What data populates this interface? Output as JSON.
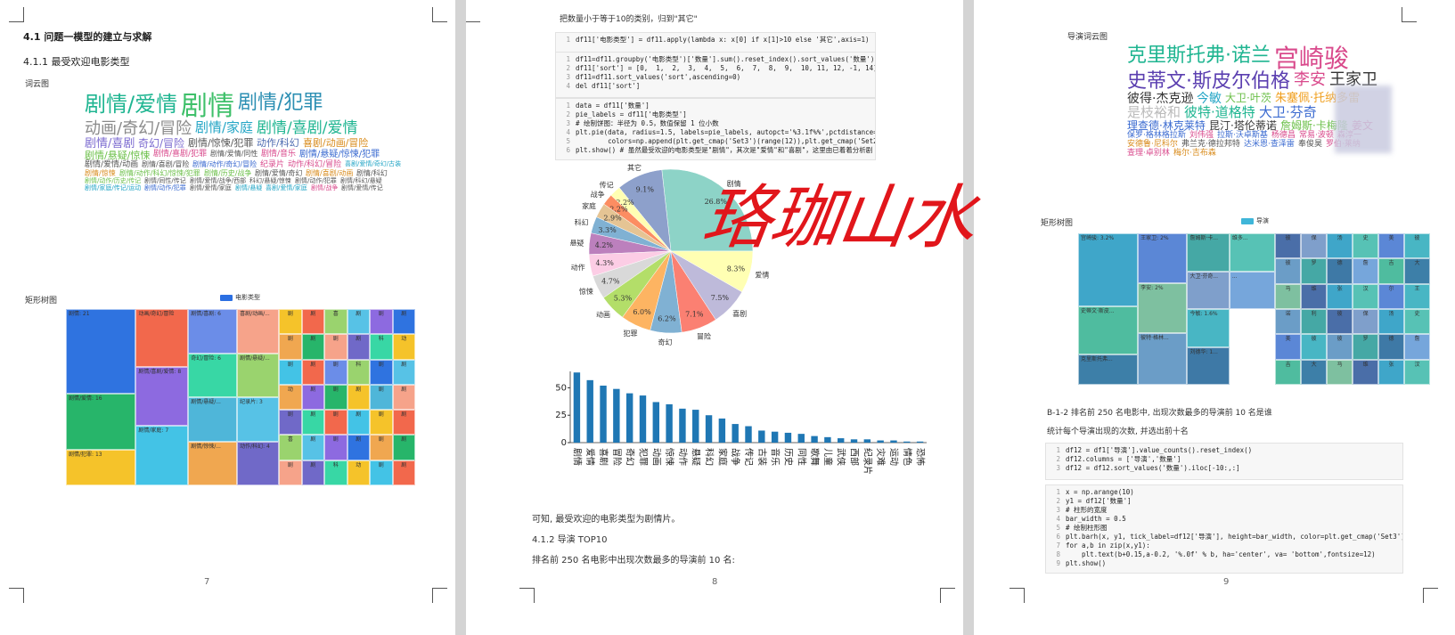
{
  "pages": [
    {
      "number": "7",
      "heading": "4.1 问题一模型的建立与求解",
      "subheading": "4.1.1 最受欢迎电影类型",
      "wordcloud_label": "词云图",
      "treemap_label": "矩形树图",
      "treemap_legend": "电影类型",
      "wordcloud": [
        {
          "t": "剧情/爱情",
          "c": "#1fb591",
          "s": 24
        },
        {
          "t": "剧情",
          "c": "#3fc06a",
          "s": 30
        },
        {
          "t": "剧情/犯罪",
          "c": "#2c8fb3",
          "s": 22
        },
        {
          "t": "动画/奇幻/冒险",
          "c": "#8a8a8a",
          "s": 18
        },
        {
          "t": "剧情/家庭",
          "c": "#25a6c6",
          "s": 15
        },
        {
          "t": "剧情/喜剧/爱情",
          "c": "#1fb591",
          "s": 17
        },
        {
          "t": "剧情/喜剧",
          "c": "#7c6bd0",
          "s": 13
        },
        {
          "t": "奇幻/冒险",
          "c": "#7c6bd0",
          "s": 12
        },
        {
          "t": "剧情/惊悚/犯罪",
          "c": "#555",
          "s": 11
        },
        {
          "t": "动作/科幻",
          "c": "#4c6ab0",
          "s": 11
        },
        {
          "t": "喜剧/动画/冒险",
          "c": "#d98c1e",
          "s": 11
        },
        {
          "t": "剧情/悬疑/惊悚",
          "c": "#6cc04a",
          "s": 11
        },
        {
          "t": "剧情/喜剧/犯罪",
          "c": "#d94a8c",
          "s": 9
        },
        {
          "t": "剧情/爱情/同性",
          "c": "#555",
          "s": 8
        },
        {
          "t": "剧情/音乐",
          "c": "#d94a8c",
          "s": 9
        },
        {
          "t": "剧情/悬疑/惊悚/犯罪",
          "c": "#3a6ad0",
          "s": 10
        },
        {
          "t": "剧情/爱情/动画",
          "c": "#555",
          "s": 9
        },
        {
          "t": "剧情/喜剧/冒险",
          "c": "#555",
          "s": 8
        },
        {
          "t": "剧情/动作/奇幻/冒险",
          "c": "#3a6ad0",
          "s": 8
        },
        {
          "t": "纪录片",
          "c": "#d94a8c",
          "s": 9
        },
        {
          "t": "动作/科幻/冒险",
          "c": "#d94a8c",
          "s": 9
        },
        {
          "t": "喜剧/爱情/奇幻/古装",
          "c": "#25a6c6",
          "s": 7
        },
        {
          "t": "剧情/惊悚",
          "c": "#d98c1e",
          "s": 8
        },
        {
          "t": "剧情/动作/科幻/惊悚/犯罪",
          "c": "#6cc04a",
          "s": 8
        },
        {
          "t": "剧情/历史/战争",
          "c": "#6cc04a",
          "s": 8
        },
        {
          "t": "剧情/爱情/奇幻",
          "c": "#555",
          "s": 8
        },
        {
          "t": "剧情/喜剧/动画",
          "c": "#d98c1e",
          "s": 8
        },
        {
          "t": "剧情/科幻",
          "c": "#555",
          "s": 8
        },
        {
          "t": "剧情/动作/历史/传记",
          "c": "#6cc04a",
          "s": 7
        },
        {
          "t": "剧情/同性/传记",
          "c": "#555",
          "s": 7
        },
        {
          "t": "剧情/爱情/战争/西部",
          "c": "#555",
          "s": 7
        },
        {
          "t": "科幻/悬疑/惊悚",
          "c": "#555",
          "s": 7
        },
        {
          "t": "剧情/动作/犯罪",
          "c": "#555",
          "s": 7
        },
        {
          "t": "剧情/科幻/悬疑",
          "c": "#555",
          "s": 7
        },
        {
          "t": "剧情/家庭/传记/运动",
          "c": "#25a6c6",
          "s": 7
        },
        {
          "t": "剧情/动作/犯罪",
          "c": "#3a6ad0",
          "s": 7
        },
        {
          "t": "剧情/爱情/家庭",
          "c": "#555",
          "s": 7
        },
        {
          "t": "剧情/悬疑",
          "c": "#25a6c6",
          "s": 7
        },
        {
          "t": "喜剧/爱情/家庭",
          "c": "#25a6c6",
          "s": 7
        },
        {
          "t": "剧情/战争",
          "c": "#d94a8c",
          "s": 7
        },
        {
          "t": "剧情/爱情/传记",
          "c": "#555",
          "s": 7
        }
      ],
      "treemap": [
        {
          "label": "剧情: 21",
          "c": "#2f73e0"
        },
        {
          "label": "剧情/爱情: 16",
          "c": "#27b56a"
        },
        {
          "label": "剧情/犯罪: 13",
          "c": "#f5c32a"
        },
        {
          "label": "动画/奇幻/冒险",
          "c": "#f2684c"
        },
        {
          "label": "剧情/喜剧/爱情: 8",
          "c": "#8d6ae0"
        },
        {
          "label": "剧情/家庭: 7",
          "c": "#43c3e6"
        },
        {
          "label": "剧情/喜剧: 6",
          "c": "#6b8de8"
        },
        {
          "label": "奇幻/冒险: 6",
          "c": "#38d7a5"
        },
        {
          "label": "剧情/悬疑/...",
          "c": "#4fb6d9"
        },
        {
          "label": "剧情/惊悚/...",
          "c": "#f0a750"
        },
        {
          "label": "喜剧/动画/...",
          "c": "#f6a38a"
        },
        {
          "label": "剧情/悬疑/...",
          "c": "#9ad36e"
        },
        {
          "label": "纪录片: 3",
          "c": "#57c2e6"
        },
        {
          "label": "动作/科幻: 4",
          "c": "#7069c8"
        },
        {
          "label": "剧情/...",
          "c": "#3cc2a8"
        }
      ],
      "treemap_small": [
        {
          "label": "剧",
          "c": "#f5c32a"
        },
        {
          "label": "剧",
          "c": "#f2684c"
        },
        {
          "label": "喜",
          "c": "#9ad36e"
        },
        {
          "label": "剧",
          "c": "#57c2e6"
        },
        {
          "label": "剧",
          "c": "#8d6ae0"
        },
        {
          "label": "剧",
          "c": "#2f73e0"
        },
        {
          "label": "剧",
          "c": "#f0a750"
        },
        {
          "label": "剧",
          "c": "#27b56a"
        },
        {
          "label": "剧",
          "c": "#f6a38a"
        },
        {
          "label": "剧",
          "c": "#7069c8"
        },
        {
          "label": "科",
          "c": "#38d7a5"
        },
        {
          "label": "动",
          "c": "#f5c32a"
        },
        {
          "label": "剧",
          "c": "#43c3e6"
        },
        {
          "label": "剧",
          "c": "#f2684c"
        },
        {
          "label": "剧",
          "c": "#6b8de8"
        },
        {
          "label": "科",
          "c": "#9ad36e"
        },
        {
          "label": "剧",
          "c": "#2f73e0"
        },
        {
          "label": "剧",
          "c": "#57c2e6"
        },
        {
          "label": "动",
          "c": "#f0a750"
        },
        {
          "label": "剧",
          "c": "#8d6ae0"
        },
        {
          "label": "剧",
          "c": "#27b56a"
        },
        {
          "label": "剧",
          "c": "#f5c32a"
        },
        {
          "label": "剧",
          "c": "#4fb6d9"
        },
        {
          "label": "剧",
          "c": "#f6a38a"
        },
        {
          "label": "剧",
          "c": "#7069c8"
        },
        {
          "label": "剧",
          "c": "#38d7a5"
        },
        {
          "label": "剧",
          "c": "#f2684c"
        },
        {
          "label": "剧",
          "c": "#43c3e6"
        }
      ]
    },
    {
      "number": "8",
      "intro": "把数量小于等于10的类别，归到\"其它\"",
      "code1": [
        "df11['电影类型'] = df11.apply(lambda x: x[0] if x[1]>10 else '其它',axis=1)"
      ],
      "code2": [
        "df11=df11.groupby('电影类型')['数量'].sum().reset_index().sort_values('数量')",
        "df11['sort'] = [0,  1,  2,  3,  4,  5,  6,  7,  8,  9,  10, 11, 12, -1, 14] # 用于排序，正",
        "df11=df11.sort_values('sort',ascending=0)",
        "del df11['sort']"
      ],
      "code3": [
        "data = df11['数量']",
        "pie_labels = df11['电影类型']",
        "# 绘制饼图：半径为 0.5，数值保留 1 位小数",
        "plt.pie(data, radius=1.5, labels=pie_labels, autopct='%3.1f%%',pctdistance=0.85,",
        "        colors=np.append(plt.get_cmap('Set3')(range(12)),plt.get_cmap('Set2')(range(12)),a",
        "plt.show() # 虽然最受欢迎的电影类型是\"剧情\"，其次是\"爱情\"和\"喜剧\"，这里由已着着分析剧"
      ],
      "conclusion": "可知, 最受欢迎的电影类型为剧情片。",
      "section": "4.1.2 导演 TOP10",
      "sentence": "排名前 250 名电影中出现次数最多的导演前 10 名:"
    },
    {
      "number": "9",
      "wordcloud_label": "导演词云图",
      "treemap_label": "矩形树图",
      "treemap_legend": "导演",
      "b_text": "B-1-2 排名前 250 名电影中, 出现次数最多的导演前 10 名是谁",
      "stat_text": "统计每个导演出现的次数, 并选出前十名",
      "code1": [
        "df12 = df1['导演'].value_counts().reset_index()",
        "df12.columns = ['导演','数量']",
        "df12 = df12.sort_values('数量').iloc[-10:,:]"
      ],
      "code2": [
        "x = np.arange(10)",
        "y1 = df12['数量']",
        "# 柱形的宽度",
        "bar_width = 0.5",
        "# 绘制柱形图",
        "plt.barh(x, y1, tick_label=df12['导演'], height=bar_width, color=plt.get_cmap('Set3')(range",
        "for a,b in zip(x,y1):",
        "    plt.text(b+0.15,a-0.2, '%.0f' % b, ha='center', va= 'bottom',fontsize=12)",
        "plt.show()"
      ],
      "wordcloud": [
        {
          "t": "克里斯托弗·诺兰",
          "c": "#1fb591",
          "s": 22
        },
        {
          "t": "宫崎骏",
          "c": "#d94a8c",
          "s": 28
        },
        {
          "t": "史蒂文·斯皮尔伯格",
          "c": "#5b3fb0",
          "s": 22
        },
        {
          "t": "李安",
          "c": "#d94a8c",
          "s": 18
        },
        {
          "t": "王家卫",
          "c": "#333",
          "s": 18
        },
        {
          "t": "彼得·杰克逊",
          "c": "#333",
          "s": 14
        },
        {
          "t": "今敏",
          "c": "#25a6c6",
          "s": 14
        },
        {
          "t": "大卫·叶茨",
          "c": "#6cc04a",
          "s": 12
        },
        {
          "t": "朱塞佩·托纳多雷",
          "c": "#f0a020",
          "s": 13
        },
        {
          "t": "是枝裕和",
          "c": "#bbb",
          "s": 15
        },
        {
          "t": "彼特·道格特",
          "c": "#1fb591",
          "s": 15
        },
        {
          "t": "大卫·芬奇",
          "c": "#3a6ad0",
          "s": 15
        },
        {
          "t": "理查德·林克莱特",
          "c": "#3a6ad0",
          "s": 12
        },
        {
          "t": "昆汀·塔伦蒂诺",
          "c": "#333",
          "s": 12
        },
        {
          "t": "詹姆斯·卡梅隆",
          "c": "#6cc04a",
          "s": 12
        },
        {
          "t": "姜文",
          "c": "#d94a8c",
          "s": 12
        },
        {
          "t": "保罗·格林格拉斯",
          "c": "#3a6ad0",
          "s": 9
        },
        {
          "t": "刘伟强",
          "c": "#d94a8c",
          "s": 9
        },
        {
          "t": "拉斯·沃卓斯基",
          "c": "#3a6ad0",
          "s": 9
        },
        {
          "t": "杨德昌",
          "c": "#d94a8c",
          "s": 9
        },
        {
          "t": "常易·波顿",
          "c": "#d94a8c",
          "s": 9
        },
        {
          "t": "森淳一",
          "c": "#d94a8c",
          "s": 9
        },
        {
          "t": "安德鲁·尼科尔",
          "c": "#d98c1e",
          "s": 9
        },
        {
          "t": "弗兰克·德拉邦特",
          "c": "#555",
          "s": 9
        },
        {
          "t": "达米恩·查泽雷",
          "c": "#3a6ad0",
          "s": 9
        },
        {
          "t": "奉俊昊",
          "c": "#555",
          "s": 9
        },
        {
          "t": "罗伯·莱纳",
          "c": "#d94a8c",
          "s": 9
        },
        {
          "t": "查理·卓别林",
          "c": "#d94a8c",
          "s": 9
        },
        {
          "t": "梅尔·吉布森",
          "c": "#d98c1e",
          "s": 9
        }
      ],
      "treemap": [
        {
          "label": "宫崎骏: 3.2%",
          "c": "#3fa6c9"
        },
        {
          "label": "史蒂文·斯皮...",
          "c": "#4fbc9f"
        },
        {
          "label": "克里斯托弗...",
          "c": "#3d7fa8"
        },
        {
          "label": "王家卫: 2%",
          "c": "#5b87d6"
        },
        {
          "label": "李安: 2%",
          "c": "#7ec0a0"
        },
        {
          "label": "彼特·格林...",
          "c": "#6b9dc7"
        },
        {
          "label": "詹姆斯·卡...",
          "c": "#45a8a5"
        },
        {
          "label": "大卫·芬奇...",
          "c": "#7f9fcb"
        },
        {
          "label": "今敏: 1.6%",
          "c": "#48b6c4"
        },
        {
          "label": "刘德华: 1...",
          "c": "#3e79a6"
        },
        {
          "label": "维多...",
          "c": "#57c2b5"
        },
        {
          "label": "...",
          "c": "#76a6db"
        }
      ],
      "treemap_small": [
        {
          "label": "彼",
          "c": "#4a6ea8"
        },
        {
          "label": "保",
          "c": "#7f9fcb"
        },
        {
          "label": "汤",
          "c": "#3fa6c9"
        },
        {
          "label": "史",
          "c": "#57c2b5"
        },
        {
          "label": "美",
          "c": "#5b87d6"
        },
        {
          "label": "彼",
          "c": "#48b6c4"
        },
        {
          "label": "彼",
          "c": "#6b9dc7"
        },
        {
          "label": "罗",
          "c": "#45a8a5"
        },
        {
          "label": "德",
          "c": "#3e79a6"
        },
        {
          "label": "詹",
          "c": "#76a6db"
        },
        {
          "label": "吉",
          "c": "#4fbc9f"
        },
        {
          "label": "大",
          "c": "#3d7fa8"
        },
        {
          "label": "马",
          "c": "#7ec0a0"
        },
        {
          "label": "维",
          "c": "#4a6ea8"
        },
        {
          "label": "张",
          "c": "#3fa6c9"
        },
        {
          "label": "汉",
          "c": "#57c2b5"
        },
        {
          "label": "尔",
          "c": "#5b87d6"
        },
        {
          "label": "王",
          "c": "#48b6c4"
        },
        {
          "label": "诺",
          "c": "#6b9dc7"
        },
        {
          "label": "利",
          "c": "#45a8a5"
        }
      ]
    }
  ],
  "watermark": "珞珈山水",
  "chart_data": [
    {
      "type": "pie",
      "categories": [
        "剧情",
        "其它",
        "传记",
        "战争",
        "家庭",
        "科幻",
        "悬疑",
        "动作",
        "惊悚",
        "动画",
        "犯罪",
        "奇幻",
        "冒险",
        "喜剧",
        "爱情"
      ],
      "values": [
        26.8,
        9.1,
        2.2,
        2.2,
        2.9,
        3.3,
        4.2,
        4.3,
        4.7,
        5.3,
        6.0,
        6.2,
        7.1,
        7.5,
        8.3
      ],
      "colors": [
        "#8dd3c7",
        "#8da0cb",
        "#ffffb3",
        "#fc8d62",
        "#e5c494",
        "#80b1d3",
        "#bc80bd",
        "#fccde5",
        "#d9d9d9",
        "#b3de69",
        "#fdb462",
        "#80b1d3",
        "#fb8072",
        "#bebada",
        "#ffffb3"
      ]
    },
    {
      "type": "bar",
      "categories": [
        "剧情",
        "爱情",
        "喜剧",
        "冒险",
        "奇幻",
        "犯罪",
        "动画",
        "惊悚",
        "动作",
        "悬疑",
        "科幻",
        "家庭",
        "战争",
        "传记",
        "古装",
        "音乐",
        "历史",
        "同性",
        "歌舞",
        "儿童",
        "武侠",
        "西部",
        "纪录片",
        "灾难",
        "运动",
        "情色",
        "恐怖"
      ],
      "values": [
        64,
        57,
        52,
        49,
        45,
        43,
        37,
        35,
        31,
        30,
        25,
        22,
        17,
        15,
        11,
        10,
        9,
        8,
        6,
        5,
        4,
        3,
        3,
        2,
        2,
        1,
        1
      ],
      "ylim": [
        0,
        65
      ],
      "yticks": [
        "0",
        "25",
        "50"
      ]
    }
  ]
}
